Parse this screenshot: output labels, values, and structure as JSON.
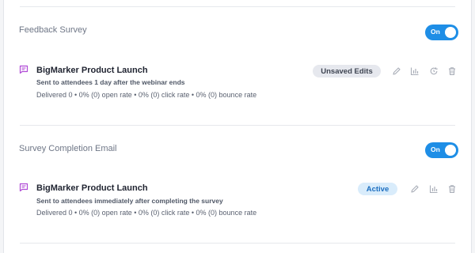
{
  "sections": [
    {
      "title": "Feedback Survey",
      "toggle_label": "On",
      "item": {
        "title": "BigMarker Product Launch",
        "subtitle": "Sent to attendees 1 day after the webinar ends",
        "stats": "Delivered 0 • 0% (0) open rate • 0% (0) click rate • 0% (0) bounce rate",
        "badge": "Unsaved Edits",
        "actions": [
          "pencil-icon",
          "bar-chart-icon",
          "history-icon",
          "trash-icon"
        ]
      }
    },
    {
      "title": "Survey Completion Email",
      "toggle_label": "On",
      "item": {
        "title": "BigMarker Product Launch",
        "subtitle": "Sent to attendees immediately after completing the survey",
        "stats": "Delivered 0 • 0% (0) open rate • 0% (0) click rate • 0% (0) bounce rate",
        "badge": "Active",
        "actions": [
          "pencil-icon",
          "bar-chart-icon",
          "trash-icon"
        ]
      }
    }
  ],
  "colors": {
    "accent": "#1e8ee6",
    "email_icon": "#b04ad6",
    "badge_gray_bg": "#e6e8ee",
    "badge_blue_bg": "#d9ecfb",
    "badge_blue_text": "#1d6fc0"
  }
}
